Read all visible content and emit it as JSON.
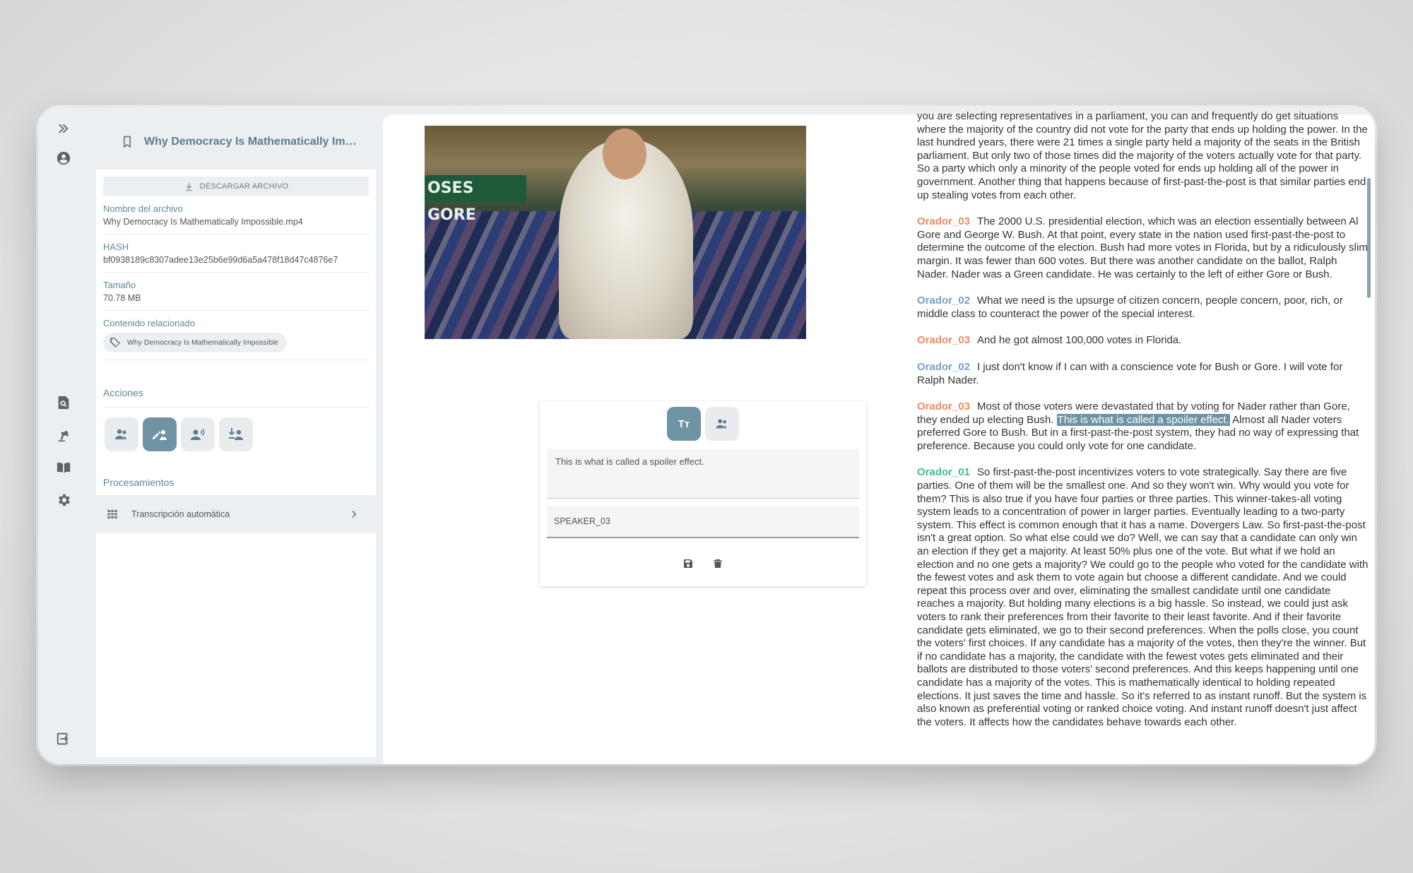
{
  "sidebar": {
    "expand_icon": "double-chevron-right-icon",
    "icons": [
      "account-circle-icon",
      "document-search-icon",
      "robot-arm-icon",
      "book-icon",
      "gear-icon",
      "logout-icon"
    ]
  },
  "file_panel": {
    "title": "Why Democracy Is Mathematically Impo...",
    "download_label": "DESCARGAR ARCHIVO",
    "fields": {
      "name_label": "Nombre del archivo",
      "name_value": "Why Democracy Is Mathematically Impossible.mp4",
      "hash_label": "HASH",
      "hash_value": "bf0938189c8307adee13e25b6e99d6a5a478f18d47c4876e7",
      "size_label": "Tamaño",
      "size_value": "70.78 MB",
      "related_label": "Contenido relacionado",
      "related_chip": "Why Democracy Is Mathematically Impossible"
    },
    "actions_label": "Acciones",
    "processing_label": "Procesamientos",
    "processing_item": "Transcripción automática"
  },
  "video": {
    "banner_text": "OSES GORE"
  },
  "editor": {
    "text_mode_label": "Tт",
    "segment_text": "This is what is called a spoiler effect.",
    "speaker_value": "SPEAKER_03"
  },
  "transcript": {
    "p0": "you are selecting representatives in a parliament, you can and frequently do get situations where the majority of the country did not vote for the party that ends up holding the power. In the last hundred years, there were 21 times a single party held a majority of the seats in the British parliament. But only two of those times did the majority of the voters actually vote for that party. So a party which only a minority of the people voted for ends up holding all of the power in government. Another thing that happens because of first-past-the-post is that similar parties end up stealing votes from each other.",
    "p1_speaker": "Orador_03",
    "p1": "The 2000 U.S. presidential election, which was an election essentially between Al Gore and George W. Bush. At that point, every state in the nation used first-past-the-post to determine the outcome of the election. Bush had more votes in Florida, but by a ridiculously slim margin. It was fewer than 600 votes. But there was another candidate on the ballot, Ralph Nader. Nader was a Green candidate. He was certainly to the left of either Gore or Bush.",
    "p2_speaker": "Orador_02",
    "p2": "What we need is the upsurge of citizen concern, people concern, poor, rich, or middle class to counteract the power of the special interest.",
    "p3_speaker": "Orador_03",
    "p3": "And he got almost 100,000 votes in Florida.",
    "p4_speaker": "Orador_02",
    "p4": "I just don't know if I can with a conscience vote for Bush or Gore. I will vote for Ralph Nader.",
    "p5_speaker": "Orador_03",
    "p5_a": "Most of those voters were devastated that by voting for Nader rather than Gore, they ended up electing Bush.",
    "p5_hl": "This is what is called a spoiler effect.",
    "p5_b": "Almost all Nader voters preferred Gore to Bush. But in a first-past-the-post system, they had no way of expressing that preference. Because you could only vote for one candidate.",
    "p6_speaker": "Orador_01",
    "p6": "So first-past-the-post incentivizes voters to vote strategically. Say there are five parties. One of them will be the smallest one. And so they won't win. Why would you vote for them? This is also true if you have four parties or three parties. This winner-takes-all voting system leads to a concentration of power in larger parties. Eventually leading to a two-party system. This effect is common enough that it has a name. Dovergers Law. So first-past-the-post isn't a great option. So what else could we do? Well, we can say that a candidate can only win an election if they get a majority. At least 50% plus one of the vote. But what if we hold an election and no one gets a majority? We could go to the people who voted for the candidate with the fewest votes and ask them to vote again but choose a different candidate. And we could repeat this process over and over, eliminating the smallest candidate until one candidate reaches a majority. But holding many elections is a big hassle. So instead, we could just ask voters to rank their preferences from their favorite to their least favorite. And if their favorite candidate gets eliminated, we go to their second preferences. When the polls close, you count the voters' first choices. If any candidate has a majority of the votes, then they're the winner. But if no candidate has a majority, the candidate with the fewest votes gets eliminated and their ballots are distributed to those voters' second preferences. And this keeps happening until one candidate has a majority of the votes. This is mathematically identical to holding repeated elections. It just saves the time and hassle. So it's referred to as instant runoff. But the system is also known as preferential voting or ranked choice voting. And instant runoff doesn't just affect the voters. It affects how the candidates behave towards each other."
  }
}
